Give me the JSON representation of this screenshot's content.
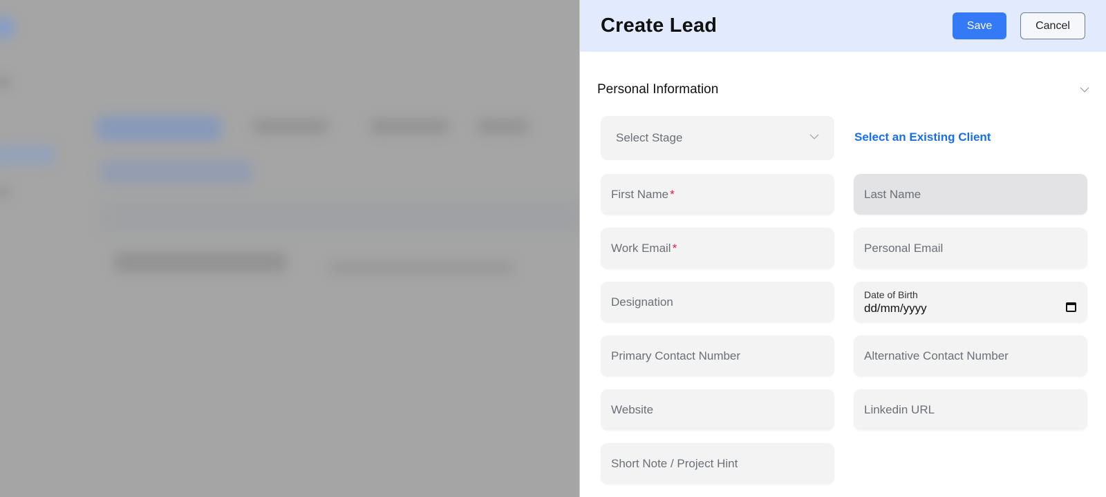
{
  "drawer": {
    "title": "Create Lead",
    "save_label": "Save",
    "cancel_label": "Cancel",
    "section_title": "Personal Information",
    "stage_select": {
      "placeholder": "Select Stage"
    },
    "existing_client_link": "Select an Existing Client",
    "fields": {
      "first_name": {
        "label": "First Name",
        "required_mark": "*"
      },
      "last_name": {
        "label": "Last Name"
      },
      "work_email": {
        "label": "Work Email",
        "required_mark": "*"
      },
      "personal_email": {
        "label": "Personal Email"
      },
      "designation": {
        "label": "Designation"
      },
      "date_of_birth": {
        "label": "Date of Birth",
        "placeholder": "dd/mm/yyyy"
      },
      "primary_contact": {
        "label": "Primary Contact Number"
      },
      "alternative_contact": {
        "label": "Alternative Contact Number"
      },
      "website": {
        "label": "Website"
      },
      "linkedin": {
        "label": "Linkedin URL"
      },
      "short_note": {
        "label": "Short Note / Project Hint"
      }
    }
  },
  "colors": {
    "primary": "#3479f6",
    "header_bg": "#e2ebfd",
    "link": "#1a6fe6",
    "required": "#e5194b"
  }
}
